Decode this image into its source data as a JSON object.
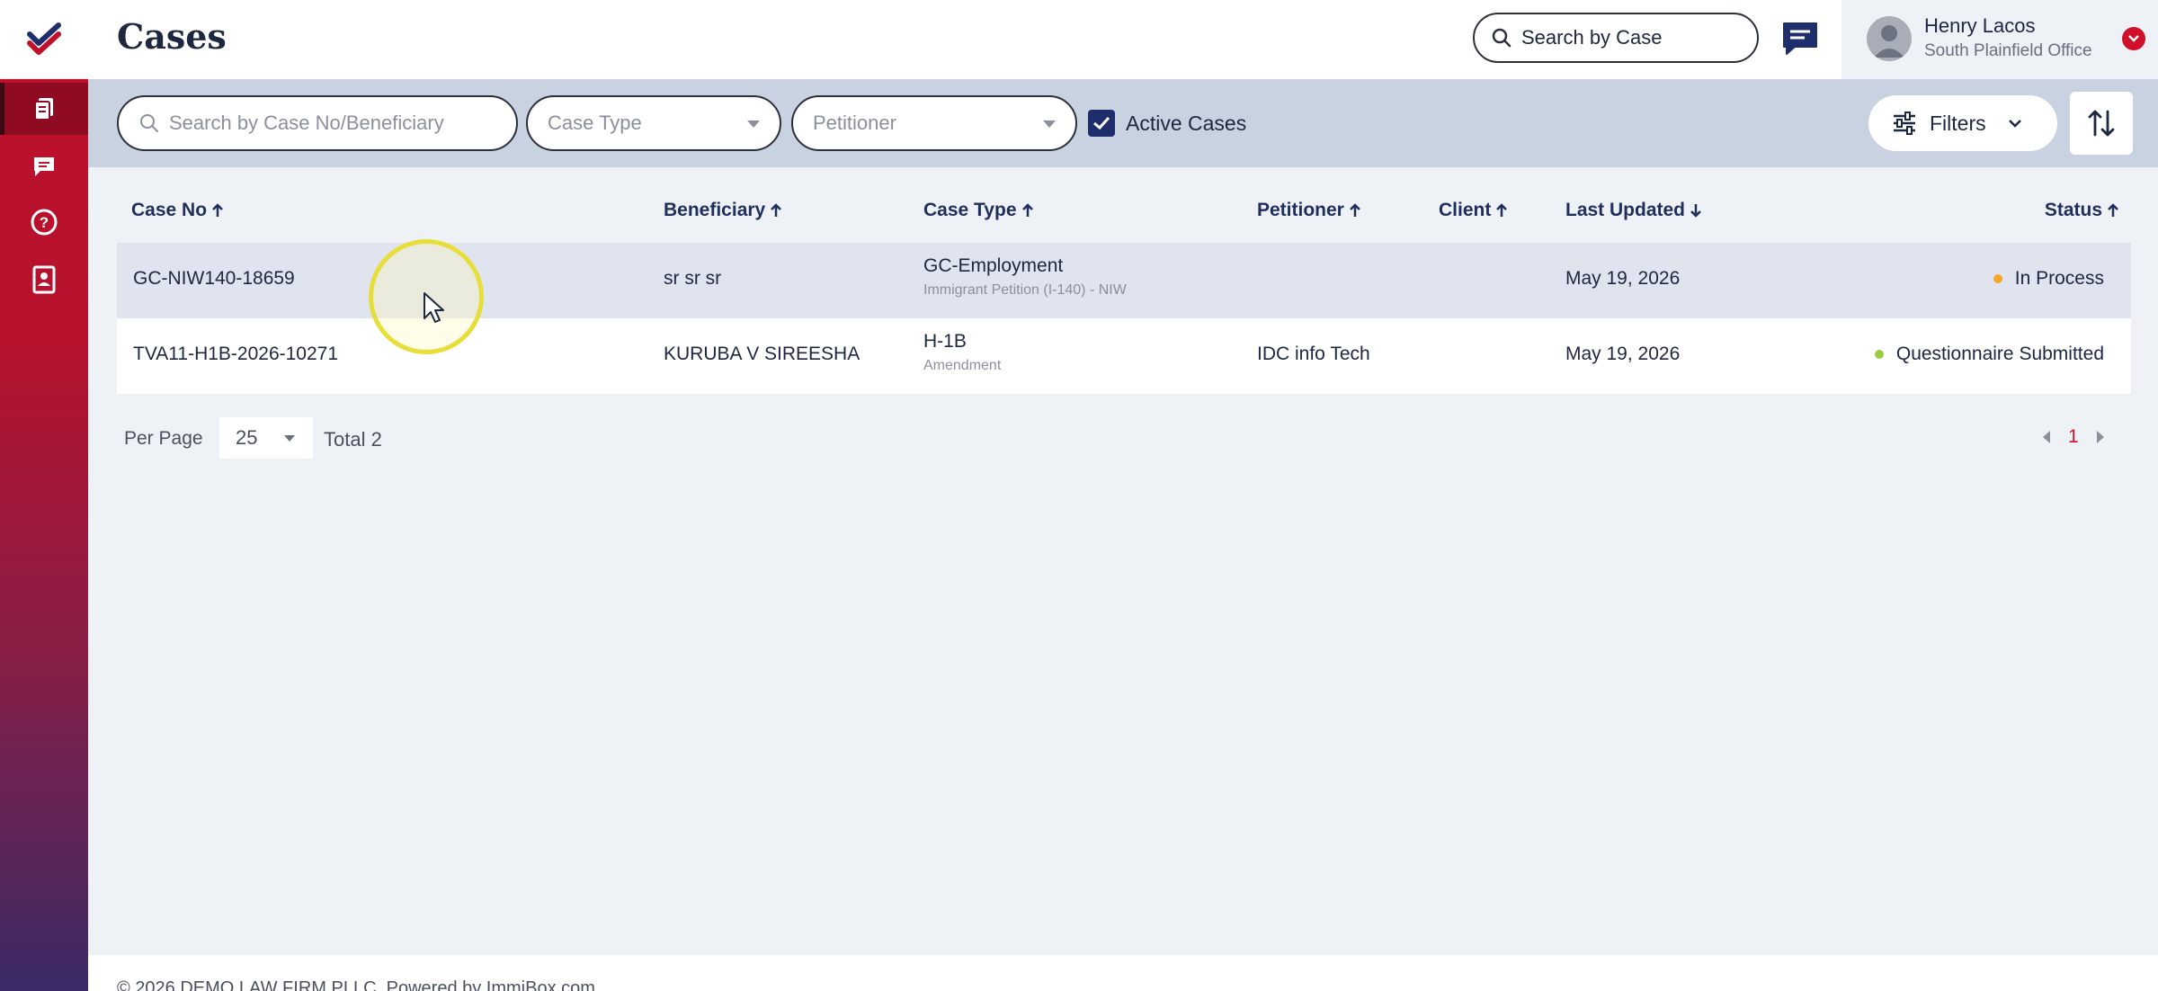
{
  "app": {
    "page_title": "Cases"
  },
  "header": {
    "search_placeholder": "Search by Case",
    "user": {
      "name": "Henry Lacos",
      "office": "South Plainfield Office"
    }
  },
  "filters": {
    "search_placeholder": "Search by Case No/Beneficiary",
    "case_type_placeholder": "Case Type",
    "petitioner_placeholder": "Petitioner",
    "active_cases_label": "Active Cases",
    "active_cases_checked": true,
    "filters_label": "Filters"
  },
  "table": {
    "columns": {
      "case_no": "Case No",
      "beneficiary": "Beneficiary",
      "case_type": "Case Type",
      "petitioner": "Petitioner",
      "client": "Client",
      "last_updated": "Last Updated",
      "status": "Status"
    },
    "rows": [
      {
        "case_no": "GC-NIW140-18659",
        "beneficiary": "sr sr sr",
        "case_type": "GC-Employment",
        "case_subtype": "Immigrant Petition (I-140) - NIW",
        "petitioner": "",
        "client": "",
        "last_updated": "May 19, 2026",
        "status": "In Process",
        "status_color": "#f5a623"
      },
      {
        "case_no": "TVA11-H1B-2026-10271",
        "beneficiary": "KURUBA V SIREESHA",
        "case_type": "H-1B",
        "case_subtype": "Amendment",
        "petitioner": "IDC info Tech",
        "client": "",
        "last_updated": "May 19, 2026",
        "status": "Questionnaire Submitted",
        "status_color": "#9ccc3c"
      }
    ]
  },
  "pagination": {
    "per_page_label": "Per Page",
    "per_page_value": "25",
    "total_label": "Total 2",
    "current_page": "1"
  },
  "footer": {
    "text": "© 2026 DEMO LAW FIRM PLLC. Powered by ImmiBox.com"
  },
  "colors": {
    "brand_red": "#c0102a",
    "navy": "#1e2d6b",
    "filter_bar": "#c9d2e1"
  }
}
